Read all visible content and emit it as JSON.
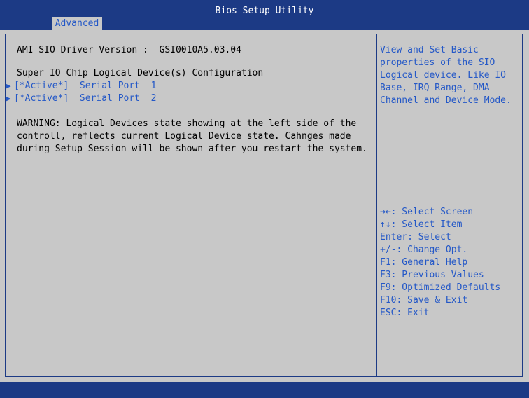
{
  "window": {
    "title": "Bios Setup Utility",
    "active_tab": "Advanced"
  },
  "content": {
    "driver_version": "AMI SIO Driver Version :  GSI0010A5.03.04",
    "section_heading": "Super IO Chip Logical Device(s) Configuration",
    "items": [
      {
        "label": "[*Active*]  Serial Port  1"
      },
      {
        "label": "[*Active*]  Serial Port  2"
      }
    ],
    "warning_lines": [
      "WARNING: Logical Devices state showing at the left side of the",
      "controll, reflects current Logical Device state. Cahnges made",
      "during Setup Session will be shown after you restart the system."
    ]
  },
  "help": {
    "lines": [
      "View and Set Basic",
      "properties of the SIO",
      "Logical device. Like IO",
      "Base, IRQ Range, DMA",
      "Channel and Device Mode."
    ]
  },
  "keys": [
    {
      "key": "→←",
      "desc": ": Select Screen"
    },
    {
      "key": "↑↓",
      "desc": ": Select Item"
    },
    {
      "key": "",
      "desc": "Enter: Select"
    },
    {
      "key": "",
      "desc": "+/-: Change Opt."
    },
    {
      "key": "",
      "desc": "F1: General Help"
    },
    {
      "key": "",
      "desc": "F3: Previous Values"
    },
    {
      "key": "",
      "desc": "F9: Optimized Defaults"
    },
    {
      "key": "",
      "desc": "F10: Save & Exit"
    },
    {
      "key": "",
      "desc": "ESC: Exit"
    }
  ],
  "colors": {
    "header_bg": "#1c3a85",
    "panel_bg": "#c8c8c8",
    "accent_text": "#2458c7"
  }
}
